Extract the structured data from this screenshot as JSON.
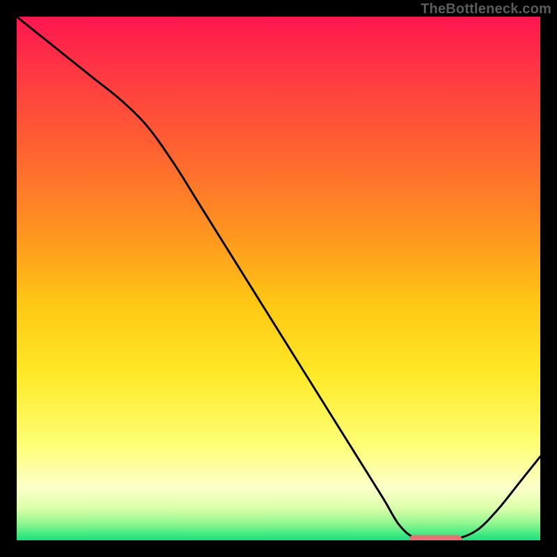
{
  "watermark": "TheBottleneck.com",
  "marker_color": "#EB6F73",
  "curve_color": "#000000",
  "chart_data": {
    "type": "line",
    "title": "",
    "xlabel": "",
    "ylabel": "",
    "xrange": [
      0,
      100
    ],
    "yrange": [
      0,
      100
    ],
    "series": [
      {
        "name": "bottleneck-curve",
        "x": [
          0,
          5,
          10,
          15,
          20,
          25,
          30,
          35,
          40,
          45,
          50,
          55,
          60,
          65,
          70,
          73,
          76,
          80,
          84,
          88,
          92,
          96,
          100
        ],
        "y": [
          100,
          96,
          92,
          88,
          84,
          79,
          72,
          64,
          56,
          48,
          40,
          32,
          24,
          16,
          8,
          3,
          0.5,
          0.3,
          0.3,
          2,
          6,
          11,
          16
        ]
      }
    ],
    "marker": {
      "name": "optimal-marker",
      "x_start": 75,
      "x_end": 85,
      "y": 0.2,
      "color": "#EB6F73"
    }
  }
}
